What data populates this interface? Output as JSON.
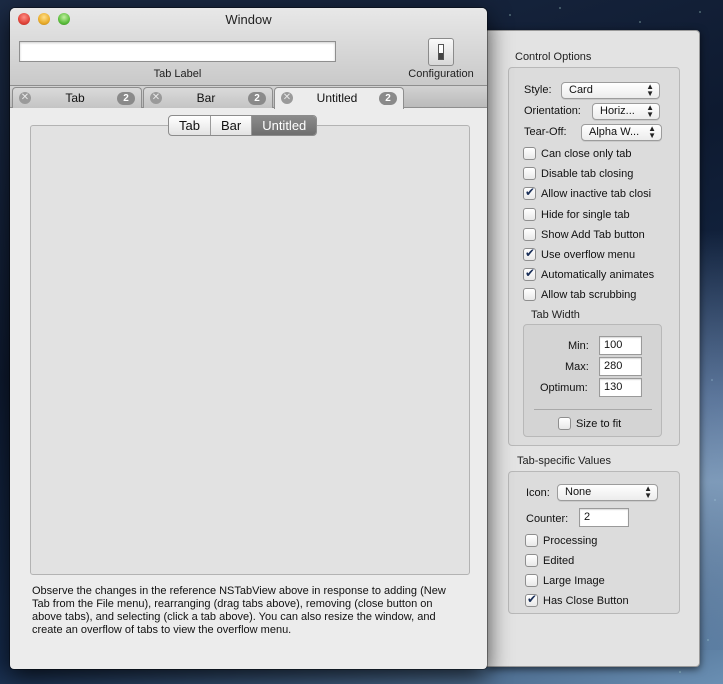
{
  "window": {
    "title": "Window",
    "tab_label_value": "",
    "tab_label_caption": "Tab Label",
    "configuration_caption": "Configuration"
  },
  "tabs": [
    {
      "label": "Tab",
      "count": "2"
    },
    {
      "label": "Bar",
      "count": "2"
    },
    {
      "label": "Untitled",
      "count": "2"
    }
  ],
  "segments": [
    "Tab",
    "Bar",
    "Untitled"
  ],
  "description": "Observe the changes in the reference NSTabView above in response to adding (New Tab from the File menu), rearranging (drag tabs above), removing (close button on above tabs), and selecting (click a tab above).  You can also resize the window, and create an overflow of tabs to view the overflow menu.",
  "control_options": {
    "title": "Control Options",
    "style_label": "Style:",
    "style_value": "Card",
    "orientation_label": "Orientation:",
    "orientation_value": "Horiz...",
    "tearoff_label": "Tear-Off:",
    "tearoff_value": "Alpha W...",
    "checkboxes": [
      {
        "label": "Can close only tab",
        "checked": false
      },
      {
        "label": "Disable tab closing",
        "checked": false
      },
      {
        "label": "Allow inactive tab closi",
        "checked": true
      },
      {
        "label": "Hide for single tab",
        "checked": false
      },
      {
        "label": "Show Add Tab button",
        "checked": false
      },
      {
        "label": "Use overflow menu",
        "checked": true
      },
      {
        "label": "Automatically animates",
        "checked": true
      },
      {
        "label": "Allow tab scrubbing",
        "checked": false
      }
    ],
    "tab_width": {
      "title": "Tab Width",
      "min_label": "Min:",
      "min_value": "100",
      "max_label": "Max:",
      "max_value": "280",
      "optimum_label": "Optimum:",
      "optimum_value": "130",
      "size_to_fit_label": "Size to fit",
      "size_to_fit_checked": false
    }
  },
  "tab_specific": {
    "title": "Tab-specific Values",
    "icon_label": "Icon:",
    "icon_value": "None",
    "counter_label": "Counter:",
    "counter_value": "2",
    "checkboxes": [
      {
        "label": "Processing",
        "checked": false
      },
      {
        "label": "Edited",
        "checked": false
      },
      {
        "label": "Large Image",
        "checked": false
      },
      {
        "label": "Has Close Button",
        "checked": true
      }
    ]
  }
}
